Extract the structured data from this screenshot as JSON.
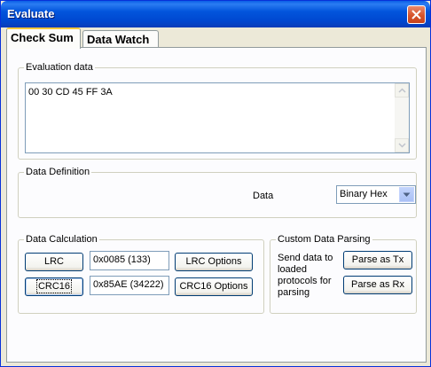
{
  "window": {
    "title": "Evaluate"
  },
  "tabs": [
    {
      "label": "Check Sum",
      "active": true
    },
    {
      "label": "Data Watch",
      "active": false
    }
  ],
  "evaluation": {
    "group_label": "Evaluation data",
    "value": "00 30 CD 45 FF 3A"
  },
  "definition": {
    "group_label": "Data Definition",
    "data_label": "Data",
    "data_type_selected": "Binary Hex"
  },
  "calculation": {
    "group_label": "Data Calculation",
    "lrc_button": "LRC",
    "lrc_value": "0x0085 (133)",
    "lrc_options_button": "LRC Options",
    "crc_button": "CRC16",
    "crc_value": "0x85AE (34222)",
    "crc_options_button": "CRC16 Options"
  },
  "parsing": {
    "group_label": "Custom Data Parsing",
    "description": "Send data to loaded protocols for parsing",
    "parse_tx_button": "Parse as Tx",
    "parse_rx_button": "Parse as Rx"
  },
  "colors": {
    "titlebar": "#0255dc",
    "close_button": "#d6542c",
    "tab_highlight": "#ffc83c",
    "panel_background": "#fcfcfe"
  },
  "icons": {
    "close": "close-icon",
    "scroll_up": "scroll-up-arrow-icon",
    "scroll_down": "scroll-down-arrow-icon",
    "dropdown": "chevron-down-icon"
  }
}
